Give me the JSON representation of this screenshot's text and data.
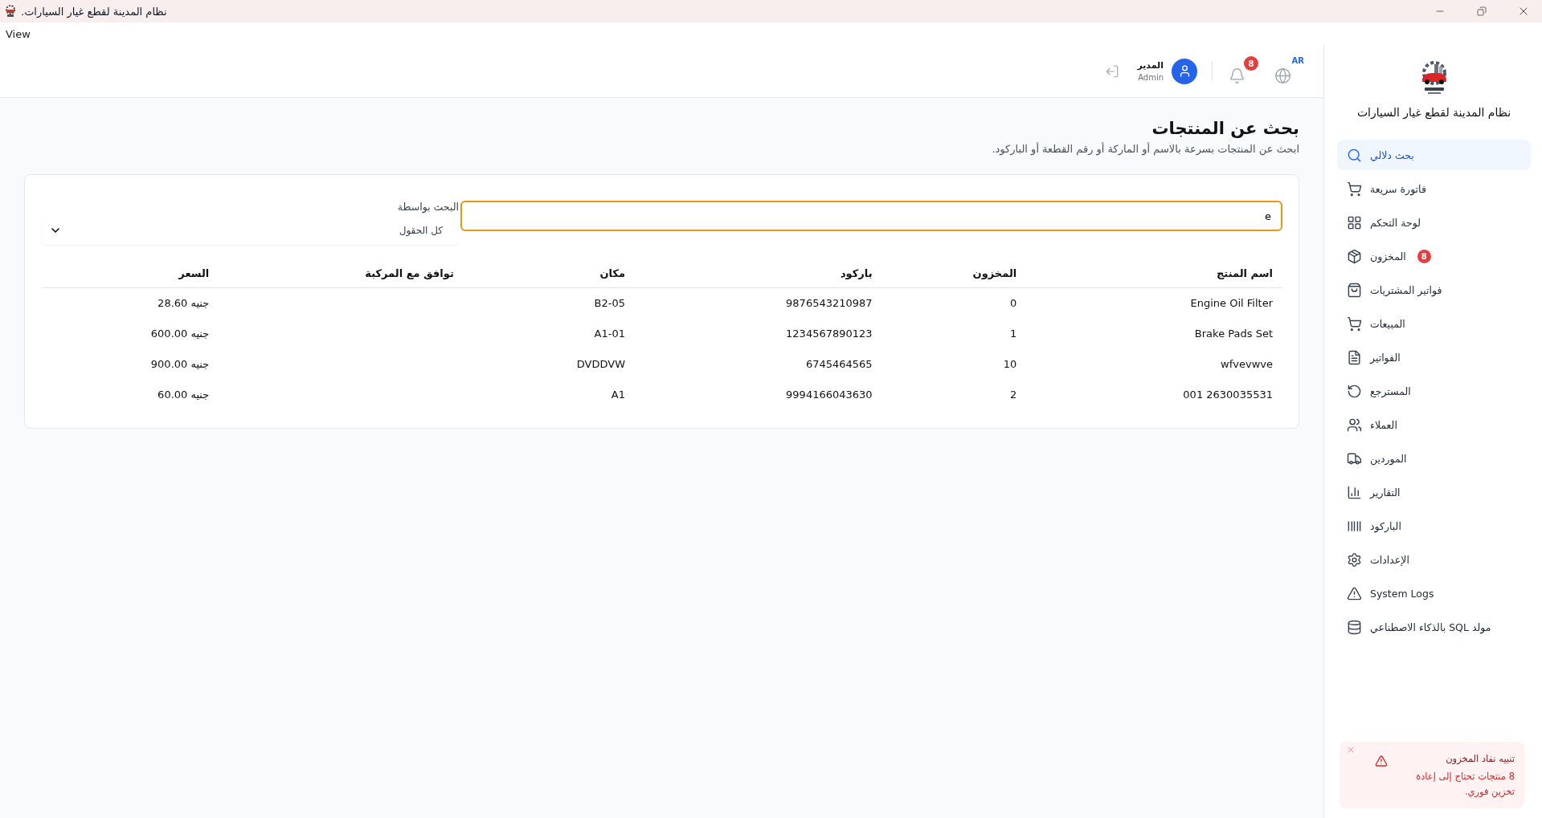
{
  "window": {
    "title": "نظام المدينة لقطع غيار السيارات."
  },
  "menu_bar": [
    "View"
  ],
  "sidebar": {
    "app_name": "نظام المدينة لقطع غيار السيارات",
    "items": [
      {
        "label": "بحث دلالي",
        "selected": true
      },
      {
        "label": "فاتورة سريعة",
        "selected": false
      },
      {
        "label": "لوحة التحكم",
        "selected": false
      },
      {
        "label": "المخزون",
        "selected": false,
        "badge": "8"
      },
      {
        "label": "فواتير المشتريات",
        "selected": false
      },
      {
        "label": "المبيعات",
        "selected": false
      },
      {
        "label": "الفواتير",
        "selected": false
      },
      {
        "label": "المسترجع",
        "selected": false
      },
      {
        "label": "العملاء",
        "selected": false
      },
      {
        "label": "الموردين",
        "selected": false
      },
      {
        "label": "التقارير",
        "selected": false
      },
      {
        "label": "الباركود",
        "selected": false
      },
      {
        "label": "الإعدادات",
        "selected": false
      },
      {
        "label": "System Logs",
        "selected": false
      },
      {
        "label": "مولد SQL بالذكاء الاصطناعي",
        "selected": false
      }
    ]
  },
  "header": {
    "language": "AR",
    "notifications": "8",
    "user": {
      "name": "المدير",
      "role": "Admin"
    }
  },
  "page": {
    "title": "بحث عن المنتجات",
    "subtitle": "ابحث عن المنتجات بسرعة بالاسم أو الماركة أو رقم القطعة أو الباركود."
  },
  "search": {
    "value": "e",
    "focused": true
  },
  "filter": {
    "label": "البحث بواسطة",
    "value": "كل الحقول"
  },
  "table": {
    "columns": [
      "اسم المنتج",
      "المخزون",
      "باركود",
      "مكان",
      "توافق مع المركبة",
      "السعر"
    ],
    "rows": [
      {
        "name": "Engine Oil Filter",
        "stock": "0",
        "barcode": "9876543210987",
        "location": "B2-05",
        "price": "جنيه 28.60"
      },
      {
        "name": "Brake Pads Set",
        "stock": "1",
        "barcode": "1234567890123",
        "location": "A1-01",
        "price": "جنيه 600.00"
      },
      {
        "name": "wfvevwve",
        "stock": "10",
        "barcode": "6745464565",
        "location": "DVDDVW",
        "price": "جنيه 900.00"
      },
      {
        "name": "001 2630035531",
        "stock": "2",
        "barcode": "9994166043630",
        "location": "A1",
        "price": "جنيه 60.00"
      }
    ]
  },
  "toast": {
    "title": "تنبيه نفاد المخزون",
    "message": "8 منتجات تحتاج إلى إعادة تخزين فوري."
  }
}
